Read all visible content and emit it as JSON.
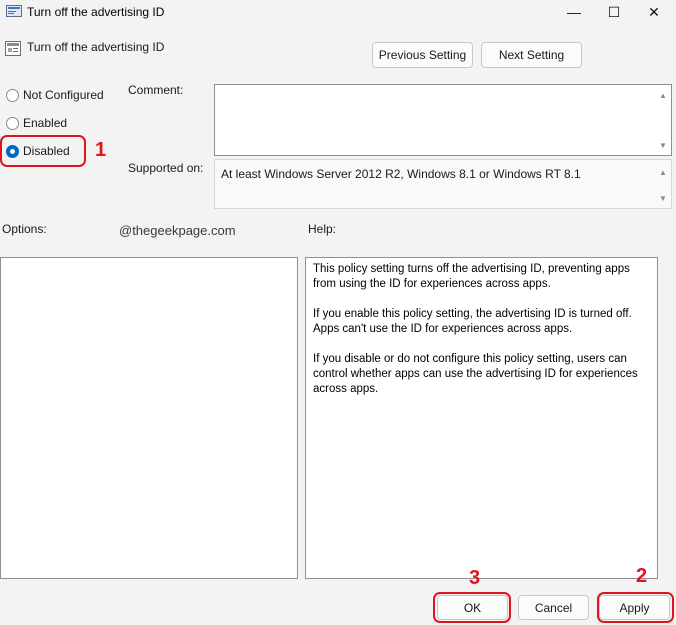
{
  "window": {
    "title": "Turn off the advertising ID",
    "icon": "policy-doc-icon",
    "controls": {
      "minimize": "—",
      "maximize": "☐",
      "close": "✕"
    }
  },
  "header": {
    "policy_name": "Turn off the advertising ID",
    "previous_label": "Previous Setting",
    "next_label": "Next Setting"
  },
  "state": {
    "options": [
      {
        "label": "Not Configured",
        "checked": false
      },
      {
        "label": "Enabled",
        "checked": false
      },
      {
        "label": "Disabled",
        "checked": true
      }
    ]
  },
  "comment": {
    "label": "Comment:",
    "value": ""
  },
  "supported": {
    "label": "Supported on:",
    "value": "At least Windows Server 2012 R2, Windows 8.1 or Windows RT 8.1"
  },
  "watermark": "@thegeekpage.com",
  "options_label": "Options:",
  "help": {
    "label": "Help:",
    "paragraphs": [
      "This policy setting turns off the advertising ID, preventing apps from using the ID for experiences across apps.",
      "If you enable this policy setting, the advertising ID is turned off. Apps can't use the ID for experiences across apps.",
      "If you disable or do not configure this policy setting, users can control whether apps can use the advertising ID for experiences across apps."
    ]
  },
  "footer": {
    "ok_label": "OK",
    "cancel_label": "Cancel",
    "apply_label": "Apply"
  },
  "annotations": {
    "step1": "1",
    "step2": "2",
    "step3": "3"
  },
  "colors": {
    "accent": "#0067c0",
    "annotation": "#e0141e"
  }
}
